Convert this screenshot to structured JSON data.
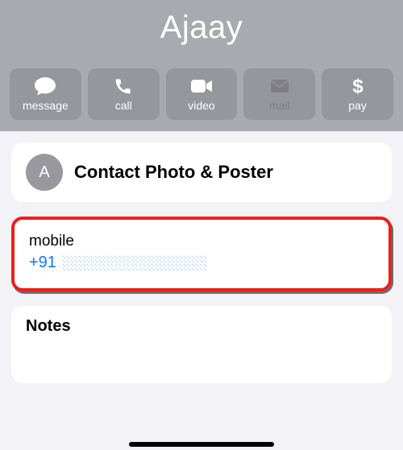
{
  "header": {
    "contactName": "Ajaay",
    "avatarInitial": "A",
    "actions": {
      "message": "message",
      "call": "call",
      "video": "video",
      "mail": "mail",
      "pay": "pay"
    }
  },
  "poster": {
    "title": "Contact Photo & Poster"
  },
  "phone": {
    "type": "mobile",
    "prefix": "+91"
  },
  "notes": {
    "title": "Notes"
  }
}
